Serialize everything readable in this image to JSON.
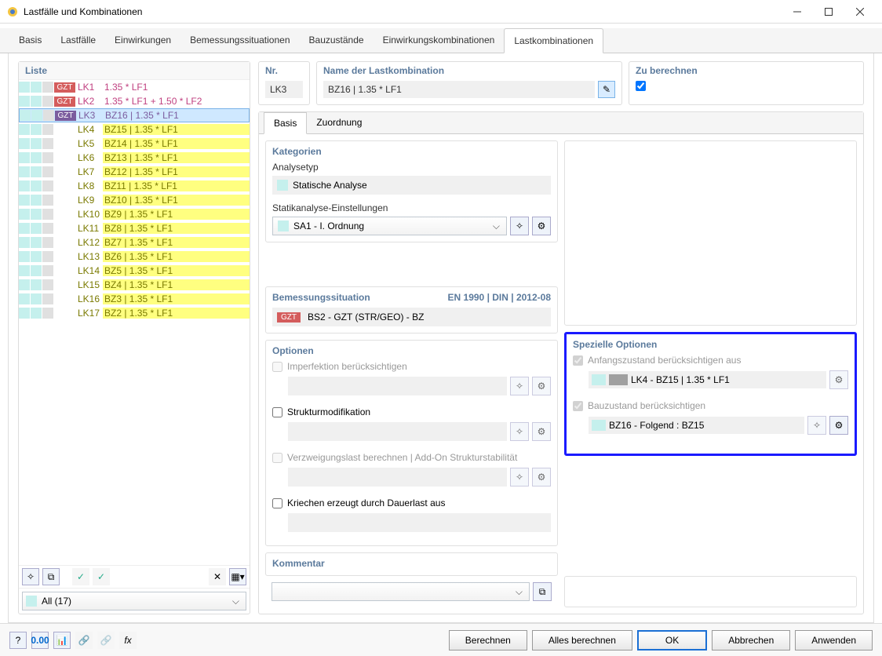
{
  "window": {
    "title": "Lastfälle und Kombinationen"
  },
  "tabs": [
    "Basis",
    "Lastfälle",
    "Einwirkungen",
    "Bemessungssituationen",
    "Bauzustände",
    "Einwirkungskombinationen",
    "Lastkombinationen"
  ],
  "activeTab": 6,
  "list": {
    "title": "Liste",
    "items": [
      {
        "badge": "GZT",
        "badgeClass": "red",
        "lk": "LK1",
        "lkClass": "lkred",
        "desc": "1.35 * LF1",
        "descClass": "descred"
      },
      {
        "badge": "GZT",
        "badgeClass": "red",
        "lk": "LK2",
        "lkClass": "lkred",
        "desc": "1.35 * LF1 + 1.50 * LF2",
        "descClass": "descred"
      },
      {
        "badge": "GZT",
        "badgeClass": "purple",
        "lk": "LK3",
        "lkClass": "lkpurple",
        "desc": "BZ16 | 1.35 * LF1",
        "descClass": "descpurple",
        "selected": true
      },
      {
        "badge": "",
        "lk": "LK4",
        "lkClass": "lkolive",
        "desc": "BZ15 | 1.35 * LF1",
        "descClass": "descolive"
      },
      {
        "badge": "",
        "lk": "LK5",
        "lkClass": "lkolive",
        "desc": "BZ14 | 1.35 * LF1",
        "descClass": "descolive"
      },
      {
        "badge": "",
        "lk": "LK6",
        "lkClass": "lkolive",
        "desc": "BZ13 | 1.35 * LF1",
        "descClass": "descolive"
      },
      {
        "badge": "",
        "lk": "LK7",
        "lkClass": "lkolive",
        "desc": "BZ12 | 1.35 * LF1",
        "descClass": "descolive"
      },
      {
        "badge": "",
        "lk": "LK8",
        "lkClass": "lkolive",
        "desc": "BZ11 | 1.35 * LF1",
        "descClass": "descolive"
      },
      {
        "badge": "",
        "lk": "LK9",
        "lkClass": "lkolive",
        "desc": "BZ10 | 1.35 * LF1",
        "descClass": "descolive"
      },
      {
        "badge": "",
        "lk": "LK10",
        "lkClass": "lkolive",
        "desc": "BZ9 | 1.35 * LF1",
        "descClass": "descolive"
      },
      {
        "badge": "",
        "lk": "LK11",
        "lkClass": "lkolive",
        "desc": "BZ8 | 1.35 * LF1",
        "descClass": "descolive"
      },
      {
        "badge": "",
        "lk": "LK12",
        "lkClass": "lkolive",
        "desc": "BZ7 | 1.35 * LF1",
        "descClass": "descolive"
      },
      {
        "badge": "",
        "lk": "LK13",
        "lkClass": "lkolive",
        "desc": "BZ6 | 1.35 * LF1",
        "descClass": "descolive"
      },
      {
        "badge": "",
        "lk": "LK14",
        "lkClass": "lkolive",
        "desc": "BZ5 | 1.35 * LF1",
        "descClass": "descolive"
      },
      {
        "badge": "",
        "lk": "LK15",
        "lkClass": "lkolive",
        "desc": "BZ4 | 1.35 * LF1",
        "descClass": "descolive"
      },
      {
        "badge": "",
        "lk": "LK16",
        "lkClass": "lkolive",
        "desc": "BZ3 | 1.35 * LF1",
        "descClass": "descolive"
      },
      {
        "badge": "",
        "lk": "LK17",
        "lkClass": "lkolive",
        "desc": "BZ2 | 1.35 * LF1",
        "descClass": "descolive"
      }
    ],
    "filter": "All (17)"
  },
  "fields": {
    "nr": {
      "label": "Nr.",
      "value": "LK3"
    },
    "name": {
      "label": "Name der Lastkombination",
      "value": "BZ16 | 1.35 * LF1"
    },
    "calc": {
      "label": "Zu berechnen"
    }
  },
  "subtabs": [
    "Basis",
    "Zuordnung"
  ],
  "kategorien": {
    "title": "Kategorien",
    "analyse_label": "Analysetyp",
    "analyse_value": "Statische Analyse",
    "statik_label": "Statikanalyse-Einstellungen",
    "statik_value": "SA1 - I. Ordnung"
  },
  "bemess": {
    "title": "Bemessungssituation",
    "right": "EN 1990 | DIN | 2012-08",
    "badge": "GZT",
    "value": "BS2 - GZT (STR/GEO) - BZ"
  },
  "optionen": {
    "title": "Optionen",
    "opt1": "Imperfektion berücksichtigen",
    "opt2": "Strukturmodifikation",
    "opt3": "Verzweigungslast berechnen | Add-On Strukturstabilität",
    "opt4": "Kriechen erzeugt durch Dauerlast aus"
  },
  "spezielle": {
    "title": "Spezielle Optionen",
    "opt1": "Anfangszustand berücksichtigen aus",
    "val1": "LK4 - BZ15 | 1.35 * LF1",
    "opt2": "Bauzustand berücksichtigen",
    "val2": "BZ16 - Folgend : BZ15"
  },
  "kommentar": {
    "title": "Kommentar"
  },
  "footer": {
    "berechnen": "Berechnen",
    "alles": "Alles berechnen",
    "ok": "OK",
    "abbrechen": "Abbrechen",
    "anwenden": "Anwenden"
  }
}
